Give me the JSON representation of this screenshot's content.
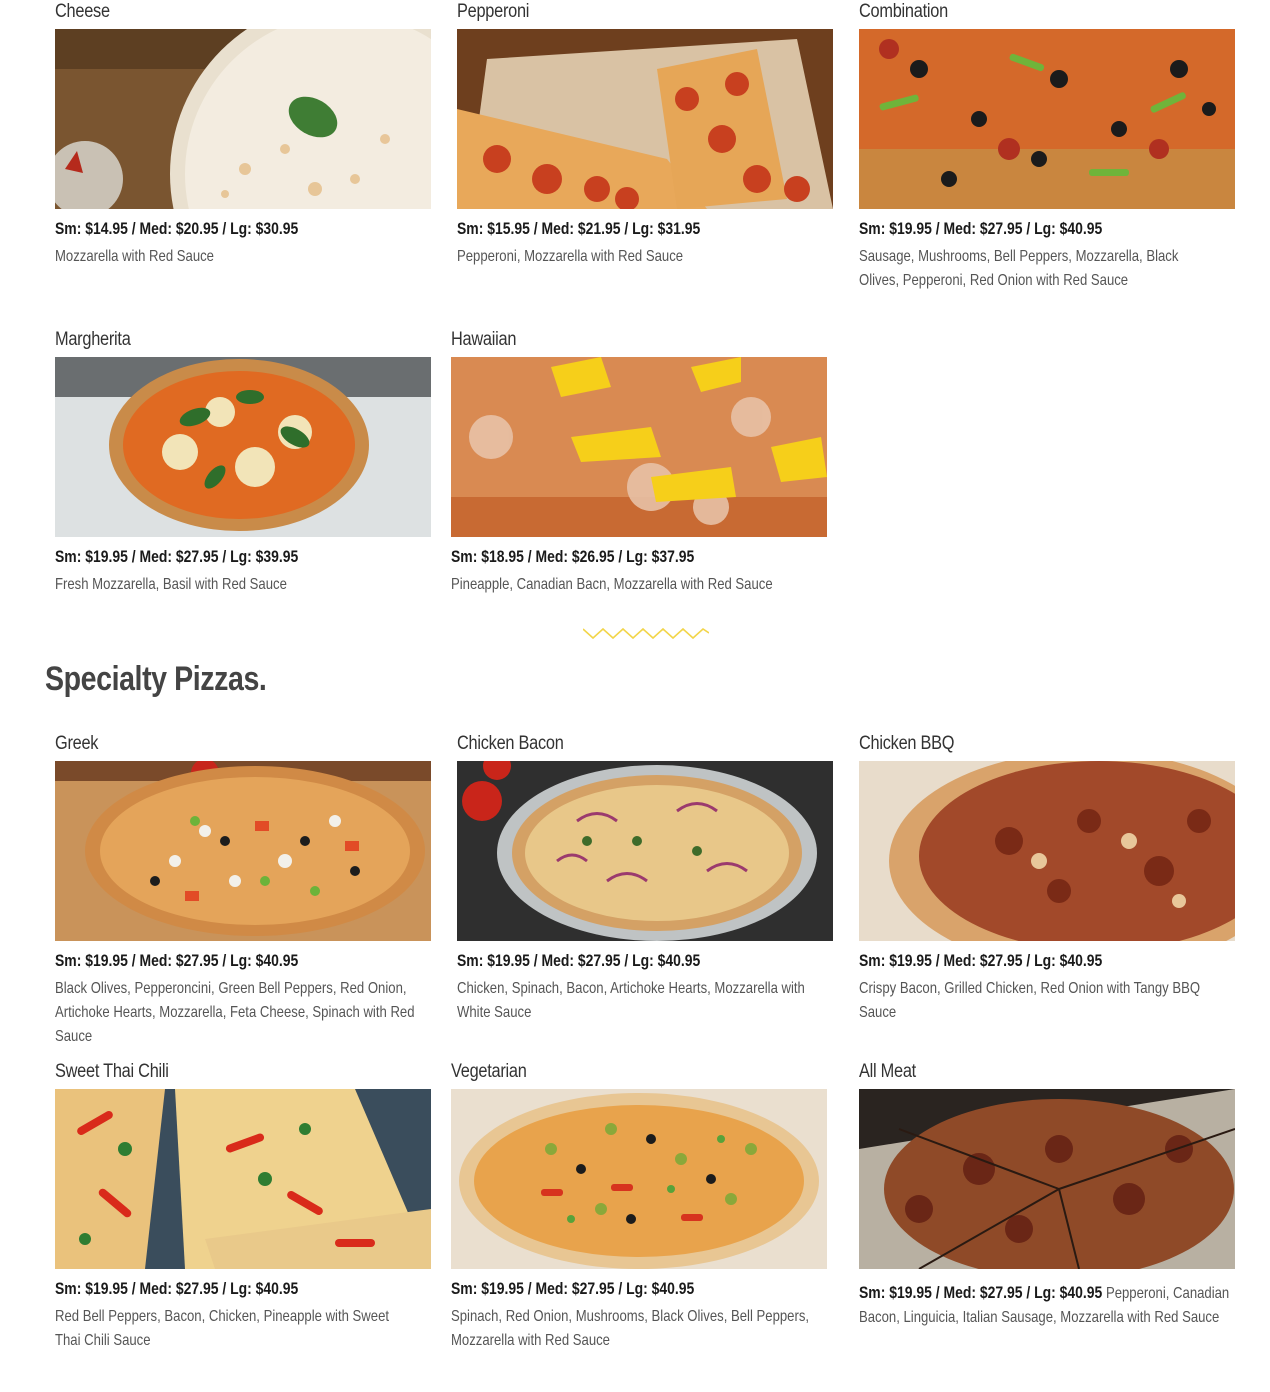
{
  "classic": [
    {
      "name": "Cheese",
      "price": "Sm: $14.95 / Med: $20.95 / Lg: $30.95",
      "desc": "Mozzarella with Red Sauce",
      "icon": "cheese-pizza-photo"
    },
    {
      "name": "Pepperoni",
      "price": "Sm: $15.95 / Med: $21.95 / Lg: $31.95",
      "desc": "Pepperoni, Mozzarella with Red Sauce",
      "icon": "pepperoni-pizza-photo"
    },
    {
      "name": "Combination",
      "price": "Sm: $19.95 / Med: $27.95 / Lg: $40.95",
      "desc": "Sausage, Mushrooms, Bell Peppers, Mozzarella, Black Olives, Pepperoni, Red Onion with Red Sauce",
      "icon": "combination-pizza-photo"
    },
    {
      "name": "Margherita",
      "price": "Sm: $19.95 / Med: $27.95 / Lg: $39.95",
      "desc": "Fresh Mozzarella, Basil with Red Sauce",
      "icon": "margherita-pizza-photo"
    },
    {
      "name": "Hawaiian",
      "price": "Sm: $18.95 / Med: $26.95 / Lg: $37.95",
      "desc": "Pineapple, Canadian Bacn, Mozzarella with Red Sauce",
      "icon": "hawaiian-pizza-photo"
    }
  ],
  "specialty_title": "Specialty Pizzas.",
  "specialty": [
    {
      "name": "Greek",
      "price": "Sm: $19.95 / Med: $27.95 / Lg: $40.95",
      "desc": "Black Olives, Pepperoncini, Green Bell Peppers, Red Onion, Artichoke Hearts, Mozzarella, Feta Cheese, Spinach with Red Sauce",
      "icon": "greek-pizza-photo"
    },
    {
      "name": "Chicken Bacon",
      "price": "Sm: $19.95 / Med: $27.95 / Lg: $40.95",
      "desc": "Chicken, Spinach, Bacon, Artichoke Hearts, Mozzarella with White Sauce",
      "icon": "chicken-bacon-pizza-photo"
    },
    {
      "name": "Chicken BBQ",
      "price": "Sm: $19.95 / Med: $27.95 / Lg: $40.95",
      "desc": "Crispy Bacon, Grilled Chicken, Red Onion with Tangy BBQ Sauce",
      "icon": "chicken-bbq-pizza-photo"
    },
    {
      "name": "Sweet Thai Chili",
      "price": "Sm: $19.95 / Med: $27.95 / Lg: $40.95",
      "desc": "Red Bell Peppers, Bacon, Chicken, Pineapple with Sweet Thai Chili Sauce",
      "icon": "sweet-thai-chili-pizza-photo"
    },
    {
      "name": "Vegetarian",
      "price": "Sm: $19.95 /  Med: $27.95 / Lg: $40.95",
      "desc": "Spinach, Red Onion, Mushrooms, Black Olives, Bell Peppers, Mozzarella with Red Sauce",
      "icon": "vegetarian-pizza-photo"
    },
    {
      "name": "All Meat",
      "price": "Sm: $19.95 /  Med: $27.95 / Lg: $40.95",
      "desc": "Pepperoni, Canadian Bacon, Linguicia, Italian Sausage, Mozzarella with Red Sauce",
      "icon": "all-meat-pizza-photo"
    }
  ],
  "colors": {
    "divider": "#f2d54a",
    "text": "#333333"
  }
}
